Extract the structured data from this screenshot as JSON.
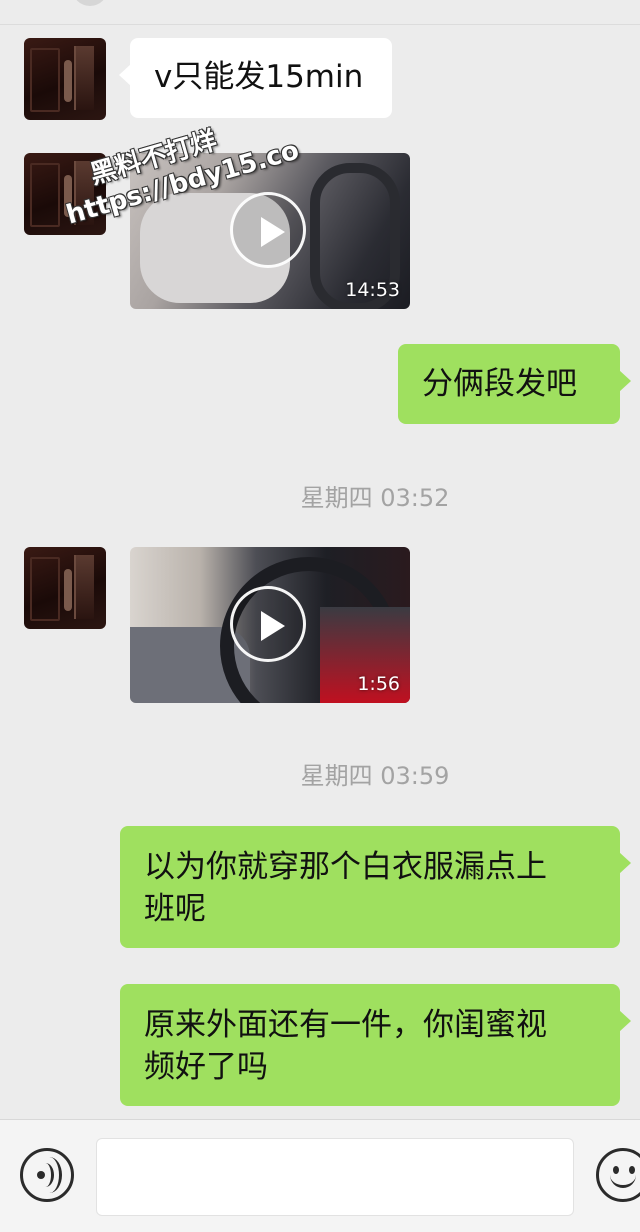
{
  "messages": [
    {
      "type": "text",
      "direction": "in",
      "text": "v只能发15min"
    },
    {
      "type": "video",
      "direction": "in",
      "duration": "14:53"
    },
    {
      "type": "text",
      "direction": "out",
      "text": "分俩段发吧"
    },
    {
      "type": "timestamp",
      "text": "星期四 03:52"
    },
    {
      "type": "video",
      "direction": "in",
      "duration": "1:56"
    },
    {
      "type": "timestamp",
      "text": "星期四 03:59"
    },
    {
      "type": "text",
      "direction": "out",
      "lines": [
        "以为你就穿那个白衣服漏点上",
        "班呢"
      ]
    },
    {
      "type": "text",
      "direction": "out",
      "lines": [
        "原来外面还有一件，你闺蜜视",
        "频好了吗"
      ]
    }
  ],
  "watermark": {
    "line1": "黑料不打烊",
    "line2": "https://bdy15.co"
  },
  "input_bar": {
    "voice_icon": "voice-icon",
    "emoji_icon": "emoji-icon",
    "value": ""
  },
  "colors": {
    "background": "#ececec",
    "outgoing_bubble": "#9fe05f",
    "incoming_bubble": "#ffffff",
    "timestamp_text": "#a3a3a3"
  }
}
